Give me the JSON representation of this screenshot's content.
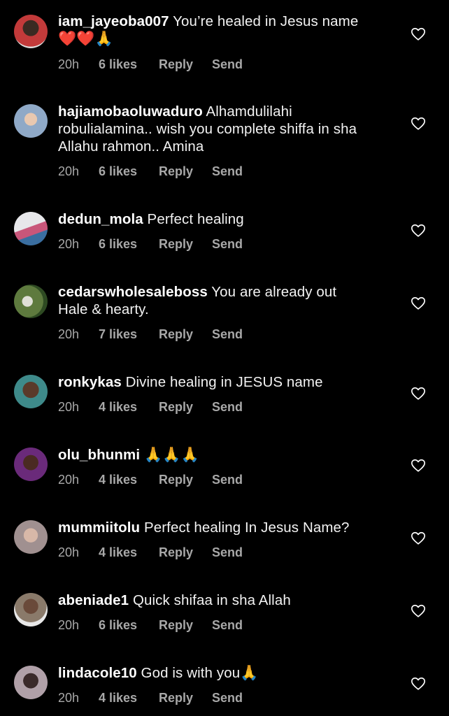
{
  "comments": [
    {
      "username": "iam_jayeoba007",
      "text": " You’re healed in Jesus name",
      "emoji": "❤️❤️🙏",
      "time": "20h",
      "likes": "6 likes",
      "reply": "Reply",
      "send": "Send",
      "avatar_color": "#c23a3a"
    },
    {
      "username": "hajiamobaoluwaduro",
      "text": " Alhamdulilahi robulialamina.. wish you complete shiffa in sha Allahu rahmon.. Amina",
      "time": "20h",
      "likes": "6 likes",
      "reply": "Reply",
      "send": "Send",
      "avatar_color": "#8fa9c7"
    },
    {
      "username": "dedun_mola",
      "text": " Perfect healing",
      "time": "20h",
      "likes": "6 likes",
      "reply": "Reply",
      "send": "Send",
      "avatar_color": "#c9567a"
    },
    {
      "username": "cedarswholesaleboss",
      "text": " You are already out Hale & hearty.",
      "time": "20h",
      "likes": "7 likes",
      "reply": "Reply",
      "send": "Send",
      "avatar_color": "#5e7a3e"
    },
    {
      "username": "ronkykas",
      "text": " Divine healing in JESUS name",
      "time": "20h",
      "likes": "4 likes",
      "reply": "Reply",
      "send": "Send",
      "avatar_color": "#3e8a8a"
    },
    {
      "username": "olu_bhunmi",
      "text": " ",
      "emoji": "🙏🙏🙏",
      "time": "20h",
      "likes": "4 likes",
      "reply": "Reply",
      "send": "Send",
      "avatar_color": "#6a2a7a"
    },
    {
      "username": "mummiitolu",
      "text": " Perfect healing In Jesus Name?",
      "time": "20h",
      "likes": "4 likes",
      "reply": "Reply",
      "send": "Send",
      "avatar_color": "#a09090"
    },
    {
      "username": "abeniade1",
      "text": " Quick shifaa in sha Allah",
      "time": "20h",
      "likes": "6 likes",
      "reply": "Reply",
      "send": "Send",
      "avatar_color": "#8a7a6a"
    },
    {
      "username": "lindacole10",
      "text": " God is with you",
      "emoji": "🙏",
      "time": "20h",
      "likes": "4 likes",
      "reply": "Reply",
      "send": "Send",
      "avatar_color": "#b0a0a8"
    }
  ]
}
